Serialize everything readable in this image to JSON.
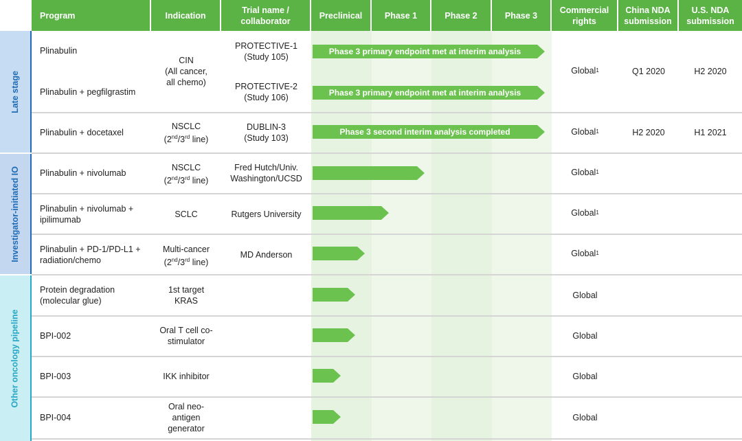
{
  "chart_data": {
    "type": "table",
    "headers": [
      "Program",
      "Indication",
      "Trial name / collaborator",
      "Preclinical",
      "Phase 1",
      "Phase 2",
      "Phase 3",
      "Commercial rights",
      "China NDA submission",
      "U.S. NDA submission"
    ],
    "groups": [
      {
        "label": "Late stage",
        "color": "#c6dcf2",
        "text_color": "#1f6bb5"
      },
      {
        "label": "Investigator-initiated IO",
        "color": "#c3d7f0",
        "text_color": "#1f6bb5"
      },
      {
        "label": "Other oncology pipeline",
        "color": "#c9eef4",
        "text_color": "#2aa7c4"
      }
    ],
    "rows": [
      {
        "program": "Plinabulin",
        "indication": "",
        "trial": "PROTECTIVE-1 (Study 105)",
        "progress": 4,
        "bar_label": "Phase 3 primary endpoint met at interim analysis",
        "rights": "Global1",
        "china": "",
        "us": ""
      },
      {
        "program": "Plinabulin + pegfilgrastim",
        "indication": "",
        "trial": "PROTECTIVE-2 (Study 106)",
        "progress": 4,
        "bar_label": "Phase 3 primary endpoint met at interim analysis",
        "rights": "",
        "china": "",
        "us": ""
      },
      {
        "program": "Plinabulin + docetaxel",
        "indication": "NSCLC (2nd/3rd line)",
        "trial": "DUBLIN-3 (Study 103)",
        "progress": 4,
        "bar_label": "Phase 3 second interim analysis completed",
        "rights": "Global1",
        "china": "H2 2020",
        "us": "H1 2021"
      },
      {
        "program": "Plinabulin + nivolumab",
        "indication": "NSCLC (2nd/3rd line)",
        "trial": "Fred Hutch/Univ. Washington/UCSD",
        "progress": 2,
        "bar_label": "",
        "rights": "Global1",
        "china": "",
        "us": ""
      },
      {
        "program": "Plinabulin + nivolumab + ipilimumab",
        "indication": "SCLC",
        "trial": "Rutgers University",
        "progress": 1.4,
        "bar_label": "",
        "rights": "Global1",
        "china": "",
        "us": ""
      },
      {
        "program": "Plinabulin + PD-1/PD-L1 + radiation/chemo",
        "indication": "Multi-cancer (2nd/3rd line)",
        "trial": "MD Anderson",
        "progress": 1,
        "bar_label": "",
        "rights": "Global1",
        "china": "",
        "us": ""
      },
      {
        "program": "Protein degradation (molecular glue)",
        "indication": "1st target KRAS",
        "trial": "",
        "progress": 0.85,
        "bar_label": "",
        "rights": "Global",
        "china": "",
        "us": ""
      },
      {
        "program": "BPI-002",
        "indication": "Oral T cell co-stimulator",
        "trial": "",
        "progress": 0.85,
        "bar_label": "",
        "rights": "Global",
        "china": "",
        "us": ""
      },
      {
        "program": "BPI-003",
        "indication": "IKK inhibitor",
        "trial": "",
        "progress": 0.6,
        "bar_label": "",
        "rights": "Global",
        "china": "",
        "us": ""
      },
      {
        "program": "BPI-004",
        "indication": "Oral neo-antigen generator",
        "trial": "",
        "progress": 0.6,
        "bar_label": "",
        "rights": "Global",
        "china": "",
        "us": ""
      }
    ],
    "merged": {
      "indication_rows_1_2": "CIN (All cancer, all chemo)",
      "rights_rows_1_2": "Global1",
      "china_rows_1_2": "Q1 2020",
      "us_rows_1_2": "H2 2020"
    },
    "bar_color": "#6cc24f",
    "header_color": "#5bb346"
  },
  "headers": {
    "program": "Program",
    "indication": "Indication",
    "trial_l1": "Trial name /",
    "trial_l2": "collaborator",
    "preclinical": "Preclinical",
    "phase1": "Phase 1",
    "phase2": "Phase 2",
    "phase3": "Phase 3",
    "rights_l1": "Commercial",
    "rights_l2": "rights",
    "china_l1": "China NDA",
    "china_l2": "submission",
    "us_l1": "U.S. NDA",
    "us_l2": "submission"
  },
  "groups": {
    "late": "Late stage",
    "iio": "Investigator-initiated IO",
    "other": "Other oncology pipeline"
  },
  "cells": {
    "r1_program": "Plinabulin",
    "r2_program": "Plinabulin + pegfilgrastim",
    "cin_l1": "CIN",
    "cin_l2": "(All cancer,",
    "cin_l3": "all chemo)",
    "r1_trial_l1": "PROTECTIVE-1",
    "r1_trial_l2": "(Study 105)",
    "r2_trial_l1": "PROTECTIVE-2",
    "r2_trial_l2": "(Study 106)",
    "r1_bar": "Phase 3 primary endpoint met at interim analysis",
    "r2_bar": "Phase 3 primary endpoint met at interim analysis",
    "r12_rights": "Global",
    "r12_china": "Q1 2020",
    "r12_us": "H2 2020",
    "r3_program": "Plinabulin + docetaxel",
    "r3_ind_l1": "NSCLC",
    "r3_ind_pre": "(2",
    "r3_ind_sup1": "nd",
    "r3_ind_mid": "/3",
    "r3_ind_sup2": "rd",
    "r3_ind_post": " line)",
    "r3_trial_l1": "DUBLIN-3",
    "r3_trial_l2": "(Study 103)",
    "r3_bar": "Phase 3 second interim analysis completed",
    "r3_rights": "Global",
    "r3_china": "H2 2020",
    "r3_us": "H1 2021",
    "r4_program": "Plinabulin + nivolumab",
    "r4_ind_l1": "NSCLC",
    "r4_ind_pre": "(2",
    "r4_ind_sup1": "nd",
    "r4_ind_mid": "/3",
    "r4_ind_sup2": "rd",
    "r4_ind_post": " line)",
    "r4_trial_l1": "Fred Hutch/Univ.",
    "r4_trial_l2": "Washington/UCSD",
    "r4_rights": "Global",
    "r5_program_l1": "Plinabulin + nivolumab +",
    "r5_program_l2": "ipilimumab",
    "r5_ind": "SCLC",
    "r5_trial": "Rutgers University",
    "r5_rights": "Global",
    "r6_program_l1": "Plinabulin + PD-1/PD-L1 +",
    "r6_program_l2": "radiation/chemo",
    "r6_ind_l1": "Multi-cancer",
    "r6_ind_pre": "(2",
    "r6_ind_sup1": "nd",
    "r6_ind_mid": "/3",
    "r6_ind_sup2": "rd",
    "r6_ind_post": " line)",
    "r6_trial": "MD Anderson",
    "r6_rights": "Global",
    "r7_program_l1": "Protein degradation",
    "r7_program_l2": "(molecular glue)",
    "r7_ind_l1": "1st target",
    "r7_ind_l2": "KRAS",
    "r7_rights": "Global",
    "r8_program": "BPI-002",
    "r8_ind_l1": "Oral T cell co-",
    "r8_ind_l2": "stimulator",
    "r8_rights": "Global",
    "r9_program": "BPI-003",
    "r9_ind": "IKK inhibitor",
    "r9_rights": "Global",
    "r10_program": "BPI-004",
    "r10_ind_l1": "Oral neo-",
    "r10_ind_l2": "antigen",
    "r10_ind_l3": "generator",
    "r10_rights": "Global",
    "footnote_mark": "1"
  }
}
